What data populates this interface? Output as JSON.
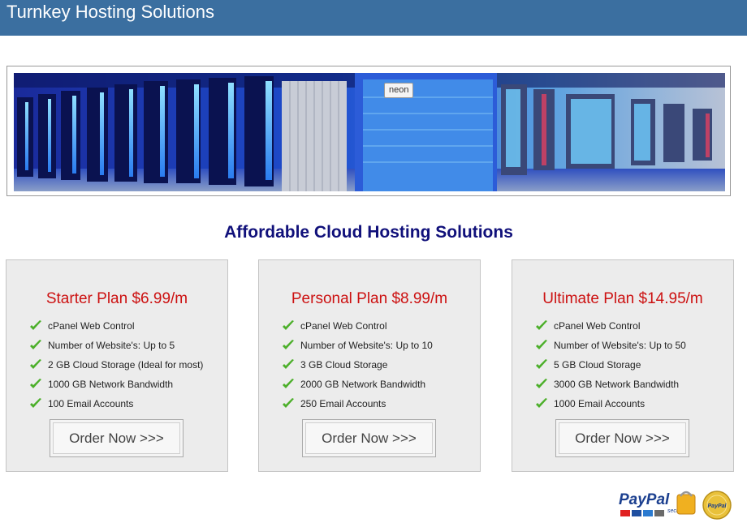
{
  "header": {
    "title": "Turnkey Hosting Solutions"
  },
  "banner": {
    "tooltip": "neon"
  },
  "main": {
    "heading": "Affordable Cloud Hosting Solutions",
    "plans": [
      {
        "title": "Starter Plan $6.99/m",
        "features": [
          "cPanel Web Control",
          "Number of Website's: Up to 5",
          "2 GB Cloud Storage (Ideal for most)",
          "1000 GB Network Bandwidth",
          "100 Email Accounts"
        ],
        "button": "Order Now >>>"
      },
      {
        "title": "Personal Plan $8.99/m",
        "features": [
          "cPanel Web Control",
          "Number of Website's: Up to 10",
          "3 GB Cloud Storage",
          "2000 GB Network Bandwidth",
          "250 Email Accounts"
        ],
        "button": "Order Now >>>"
      },
      {
        "title": "Ultimate Plan $14.95/m",
        "features": [
          "cPanel Web Control",
          "Number of Website's: Up to 50",
          "5 GB Cloud Storage",
          "3000 GB Network Bandwidth",
          "1000 Email Accounts"
        ],
        "button": "Order Now >>>"
      }
    ]
  },
  "footer": {
    "paypal_logo": "PayPal",
    "paypal_tagline": "secure",
    "paypal_seal": "PayPal"
  },
  "colors": {
    "header": "#3b6fa0",
    "heading": "#10107a",
    "plan_title": "#cc1111",
    "check": "#4caf2a"
  },
  "icons": {
    "feature": "check-icon",
    "payment": "paypal-logo"
  }
}
